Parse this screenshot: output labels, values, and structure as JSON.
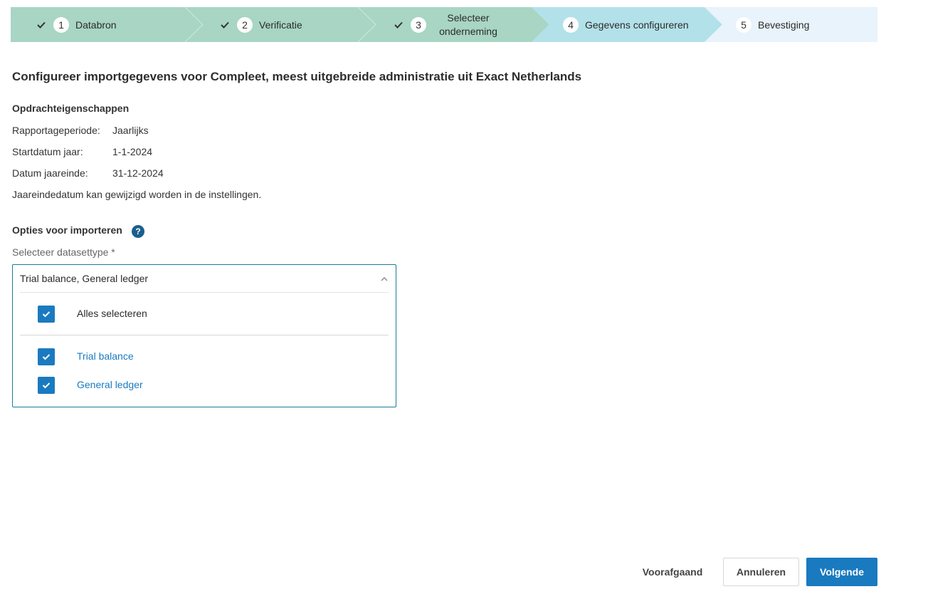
{
  "colors": {
    "step_done": "#a8d5c4",
    "step_active": "#b3e1e9",
    "step_future": "#e8f3fb",
    "primary": "#1a7ac0",
    "border_focus": "#1b7a9a",
    "help_icon": "#1a5f8e"
  },
  "stepper": {
    "steps": [
      {
        "number": "1",
        "label": "Databron",
        "state": "done",
        "icon": "check-icon"
      },
      {
        "number": "2",
        "label": "Verificatie",
        "state": "done",
        "icon": "check-icon"
      },
      {
        "number": "3",
        "label_line1": "Selecteer",
        "label_line2": "onderneming",
        "state": "done",
        "icon": "check-icon"
      },
      {
        "number": "4",
        "label": "Gegevens configureren",
        "state": "active"
      },
      {
        "number": "5",
        "label": "Bevestiging",
        "state": "future"
      }
    ]
  },
  "page": {
    "title": "Configureer importgegevens voor Compleet, meest uitgebreide administratie uit Exact Netherlands"
  },
  "properties": {
    "heading": "Opdrachteigenschappen",
    "rows": [
      {
        "label": "Rapportageperiode:",
        "value": "Jaarlijks"
      },
      {
        "label": "Startdatum jaar:",
        "value": "1-1-2024"
      },
      {
        "label": "Datum jaareinde:",
        "value": "31-12-2024"
      }
    ],
    "note": "Jaareindedatum kan gewijzigd worden in de instellingen."
  },
  "import_options": {
    "heading": "Opties voor importeren",
    "help_icon": "?",
    "field_label": "Selecteer datasettype *",
    "dropdown": {
      "value": "Trial balance, General ledger",
      "select_all": {
        "label": "Alles selecteren",
        "checked": true
      },
      "options": [
        {
          "label": "Trial balance",
          "checked": true
        },
        {
          "label": "General ledger",
          "checked": true
        }
      ]
    }
  },
  "footer": {
    "previous": "Voorafgaand",
    "cancel": "Annuleren",
    "next": "Volgende"
  }
}
